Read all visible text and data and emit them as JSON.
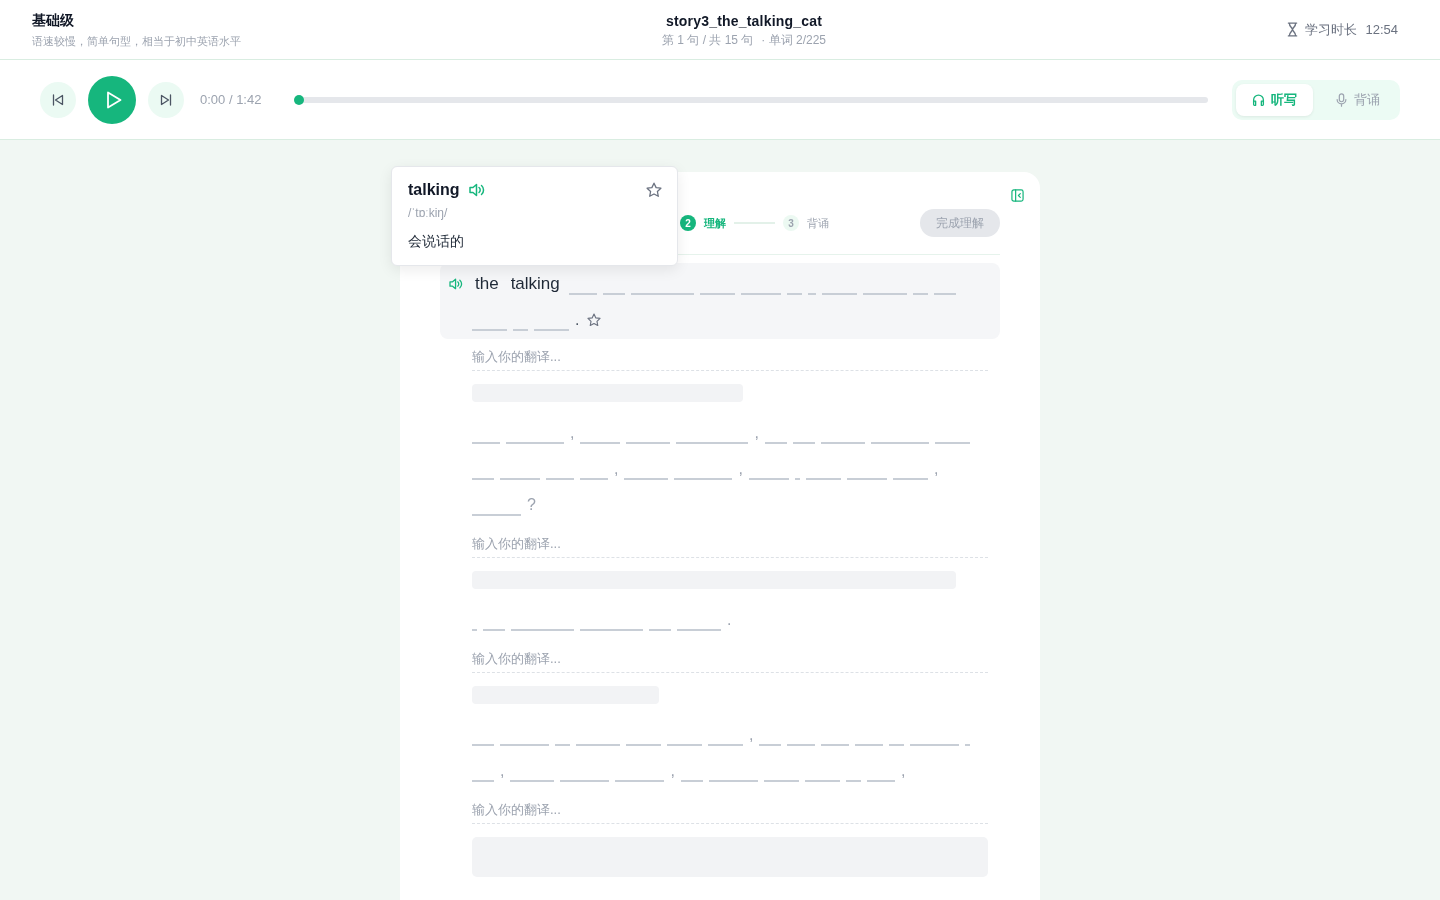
{
  "header": {
    "difficulty": {
      "title": "基础级",
      "description": "语速较慢，简单句型，相当于初中英语水平"
    },
    "story": {
      "title": "story3_the_talking_cat",
      "position": "第 1 句 / 共 15 句",
      "words": "· 单词 2/225"
    },
    "study_time": {
      "label": "学习时长",
      "value": "12:54"
    }
  },
  "player": {
    "playing": false,
    "time": "0:00 / 1:42",
    "progress": {
      "level": 0
    },
    "modes": [
      {
        "kind": "listen",
        "label": "听写",
        "selected": true
      },
      {
        "kind": "speak",
        "label": "背诵",
        "selected": false
      }
    ]
  },
  "lesson": {
    "steps": [
      {
        "number": "2",
        "label": "理解",
        "current": true
      },
      {
        "number": "3",
        "label": "背诵",
        "current": false
      }
    ],
    "complete_button": {
      "label": "完成理解",
      "disabled": true
    },
    "sentences": [
      {
        "selected": true,
        "starred": false,
        "tokens": [
          {
            "kind": "word",
            "text": "the"
          },
          {
            "kind": "word",
            "text": "talking"
          },
          {
            "kind": "blank5"
          },
          {
            "kind": "blank4"
          },
          {
            "kind": "blank11"
          },
          {
            "kind": "blank6"
          },
          {
            "kind": "blank7"
          },
          {
            "kind": "blank3"
          },
          {
            "kind": "blank2"
          },
          {
            "kind": "blank6"
          },
          {
            "kind": "blank8"
          },
          {
            "kind": "blank3"
          },
          {
            "kind": "blank4"
          },
          {
            "kind": "blank6"
          },
          {
            "kind": "blank3"
          },
          {
            "kind": "blank6"
          },
          {
            "kind": "punct",
            "text": "."
          }
        ],
        "translation": {
          "placeholder": "输入你的翻译..."
        },
        "answer_mask": {
          "kind": "medium"
        }
      },
      {
        "selected": false,
        "tokens": [
          {
            "kind": "blank5"
          },
          {
            "kind": "blank10"
          },
          {
            "kind": "punct",
            "text": ","
          },
          {
            "kind": "blank7"
          },
          {
            "kind": "blank8"
          },
          {
            "kind": "blank12"
          },
          {
            "kind": "punct",
            "text": ","
          },
          {
            "kind": "blank4"
          },
          {
            "kind": "blank4"
          },
          {
            "kind": "blank8"
          },
          {
            "kind": "blank10"
          },
          {
            "kind": "blank6"
          },
          {
            "kind": "blank4"
          },
          {
            "kind": "blank7"
          },
          {
            "kind": "blank5"
          },
          {
            "kind": "blank5"
          },
          {
            "kind": "punct",
            "text": ","
          },
          {
            "kind": "blank8"
          },
          {
            "kind": "blank10"
          },
          {
            "kind": "punct",
            "text": ","
          },
          {
            "kind": "blank7"
          },
          {
            "kind": "blank1"
          },
          {
            "kind": "blank6"
          },
          {
            "kind": "blank7"
          },
          {
            "kind": "blank6"
          },
          {
            "kind": "punct",
            "text": ","
          },
          {
            "kind": "blank9"
          },
          {
            "kind": "punct",
            "text": "?"
          }
        ],
        "translation": {
          "placeholder": "输入你的翻译..."
        },
        "answer_mask": {
          "kind": "long"
        }
      },
      {
        "selected": false,
        "tokens": [
          {
            "kind": "blank1"
          },
          {
            "kind": "blank4"
          },
          {
            "kind": "blank11"
          },
          {
            "kind": "blank11"
          },
          {
            "kind": "blank4"
          },
          {
            "kind": "blank8"
          },
          {
            "kind": "punct",
            "text": "."
          }
        ],
        "translation": {
          "placeholder": "输入你的翻译..."
        },
        "answer_mask": {
          "kind": "short"
        }
      },
      {
        "selected": false,
        "tokens": [
          {
            "kind": "blank4"
          },
          {
            "kind": "blank9"
          },
          {
            "kind": "blank3"
          },
          {
            "kind": "blank8"
          },
          {
            "kind": "blank6"
          },
          {
            "kind": "blank6"
          },
          {
            "kind": "blank6"
          },
          {
            "kind": "punct",
            "text": ","
          },
          {
            "kind": "blank4"
          },
          {
            "kind": "blank5"
          },
          {
            "kind": "blank5"
          },
          {
            "kind": "blank5"
          },
          {
            "kind": "blank3"
          },
          {
            "kind": "blank9"
          },
          {
            "kind": "blank1"
          },
          {
            "kind": "blank4"
          },
          {
            "kind": "punct",
            "text": ","
          },
          {
            "kind": "blank8"
          },
          {
            "kind": "blank9"
          },
          {
            "kind": "blank9"
          },
          {
            "kind": "punct",
            "text": ","
          },
          {
            "kind": "blank4"
          },
          {
            "kind": "blank9"
          },
          {
            "kind": "blank6"
          },
          {
            "kind": "blank6"
          },
          {
            "kind": "blank3"
          },
          {
            "kind": "blank5"
          },
          {
            "kind": "punct",
            "text": ","
          }
        ],
        "translation": {
          "placeholder": "输入你的翻译..."
        },
        "answer_mask": {
          "kind": "block"
        }
      }
    ]
  },
  "word_popup": {
    "word": "talking",
    "phonetic": "/ˈtɒːkiŋ/",
    "meaning": "会说话的",
    "starred": false
  }
}
